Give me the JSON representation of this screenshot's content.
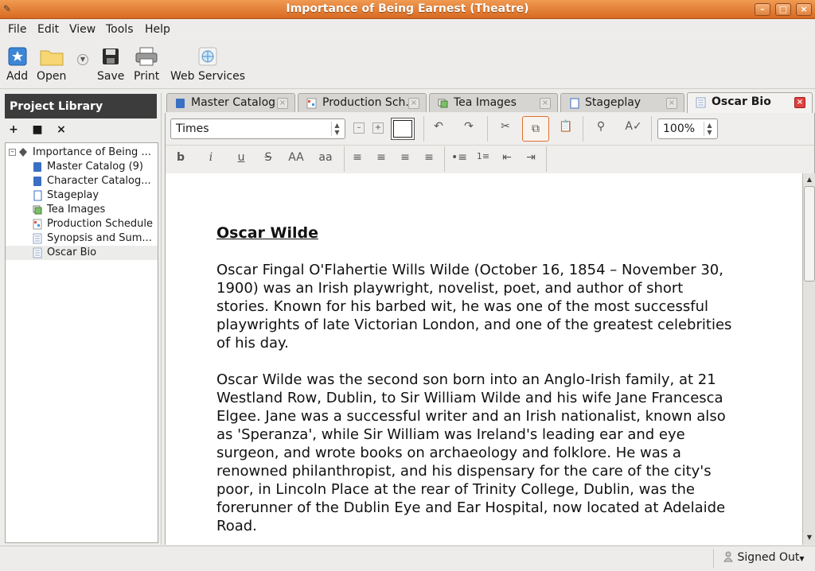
{
  "window": {
    "title": "Importance of Being Earnest (Theatre)"
  },
  "menu": [
    "File",
    "Edit",
    "View",
    "Tools",
    "Help"
  ],
  "toolbar": {
    "add": "Add",
    "open": "Open",
    "save": "Save",
    "print": "Print",
    "web_services": "Web Services"
  },
  "library": {
    "title": "Project Library",
    "items": [
      {
        "label": "Importance of Being ...",
        "icon": "project-icon"
      },
      {
        "label": "Master Catalog (9)",
        "icon": "catalog-icon"
      },
      {
        "label": "Character Catalog...",
        "icon": "catalog-icon"
      },
      {
        "label": "Stageplay",
        "icon": "script-icon"
      },
      {
        "label": "Tea Images",
        "icon": "images-icon"
      },
      {
        "label": "Production Schedule",
        "icon": "schedule-icon"
      },
      {
        "label": "Synopsis and Sum...",
        "icon": "document-icon"
      },
      {
        "label": "Oscar Bio",
        "icon": "document-icon"
      }
    ],
    "selected": "Oscar Bio"
  },
  "tabs": [
    {
      "label": "Master Catalog"
    },
    {
      "label": "Production Sch..."
    },
    {
      "label": "Tea Images"
    },
    {
      "label": "Stageplay"
    },
    {
      "label": "Oscar Bio"
    }
  ],
  "format": {
    "font": "Times",
    "zoom": "100%",
    "bold": "b",
    "italic": "i",
    "underline": "u",
    "strike": "S",
    "upper": "AA",
    "lower": "aa"
  },
  "document": {
    "title": "Oscar Wilde",
    "paragraphs": [
      "Oscar Fingal O'Flahertie Wills Wilde (October 16, 1854 – November 30, 1900) was an Irish playwright, novelist, poet, and author of short stories. Known for his barbed wit, he was one of the most successful playwrights of late Victorian London, and one of the greatest celebrities of his day.",
      "Oscar Wilde was the second son born into an Anglo-Irish family, at 21 Westland Row, Dublin, to Sir William Wilde and his wife Jane Francesca Elgee. Jane was a successful writer and an Irish nationalist, known also as 'Speranza', while Sir William was Ireland's leading ear and eye surgeon, and wrote books on archaeology and folklore. He was a renowned philanthropist, and his dispensary for the care of the city's poor, in Lincoln Place at the rear of Trinity College, Dublin, was the forerunner of the Dublin Eye and Ear Hospital, now located at Adelaide Road."
    ]
  },
  "status": {
    "signed": "Signed Out"
  }
}
